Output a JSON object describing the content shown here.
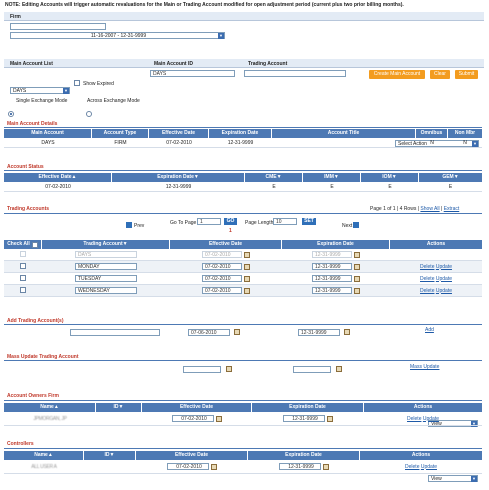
{
  "note": "NOTE: Editing Accounts will trigger automatic revaluations for the Main or Trading Account modified for open adjustment period (current plus two prior billing months).",
  "firm": {
    "label": "Firm",
    "value": "",
    "date_range": "11-16-2007 - 12-31-9999"
  },
  "filters": {
    "main_list_label": "Main Account List",
    "main_list_value": "DAYS",
    "main_id_label": "Main Account ID",
    "main_id_value": "DAYS",
    "trading_label": "Trading Account",
    "trading_value": "",
    "show_expired": "Show Expired",
    "btn_create": "Create Main Account",
    "btn_clear": "Clear",
    "btn_submit": "Submit",
    "mode_single": "Single Exchange Mode",
    "mode_across": "Across Exchange Mode"
  },
  "main_details": {
    "title": "Main Account Details",
    "select_action": "Select Action",
    "headers": [
      "Main Account",
      "Account Type",
      "Effective Date",
      "Expiration Date",
      "Account Title",
      "Omnibus",
      "Non Mbr"
    ],
    "row": [
      "DAYS",
      "FIRM",
      "07-02-2010",
      "12-31-9999",
      "",
      "N",
      "N"
    ]
  },
  "account_status": {
    "title": "Account Status",
    "headers": [
      "Effective Date▲",
      "Expiration Date▼",
      "CME▼",
      "IMM▼",
      "IOM▼",
      "GEM▼"
    ],
    "row": [
      "07-02-2010",
      "12-31-9999",
      "E",
      "E",
      "E",
      "E"
    ]
  },
  "trading_accounts": {
    "title": "Trading Accounts",
    "page_info": "Page 1 of 1",
    "rows_info": "4 Rows",
    "show_all": "Show All",
    "extract": "Extract",
    "prev": "Prev",
    "next": "Next",
    "goto_label": "Go To Page",
    "goto_value": "1",
    "go": "GO",
    "page_length_label": "Page Length",
    "page_length_value": "10",
    "set": "SET",
    "page_num": "1",
    "headers": [
      "Check All",
      "Trading Account▼",
      "Effective Date",
      "Expiration Date",
      "Actions"
    ],
    "rows": [
      {
        "name": "DAYS",
        "eff": "07-02-2010",
        "exp": "12-31-9999",
        "disabled": true,
        "delete": "",
        "update": ""
      },
      {
        "name": "MONDAY",
        "eff": "07-02-2010",
        "exp": "12-31-9999",
        "disabled": false,
        "delete": "Delete",
        "update": "Update"
      },
      {
        "name": "TUESDAY",
        "eff": "07-02-2010",
        "exp": "12-31-9999",
        "disabled": false,
        "delete": "Delete",
        "update": "Update"
      },
      {
        "name": "WEDNESDAY",
        "eff": "07-02-2010",
        "exp": "12-31-9999",
        "disabled": false,
        "delete": "Delete",
        "update": "Update"
      }
    ]
  },
  "add_trading": {
    "title": "Add Trading Account(s)",
    "eff": "07-06-2010",
    "exp": "12-31-9999",
    "add": "Add"
  },
  "mass_update": {
    "title": "Mass Update Trading Account",
    "link": "Mass Update"
  },
  "owners": {
    "title": "Account Owners Firm",
    "view": "View",
    "headers": [
      "Name▲",
      "ID▼",
      "Effective Date",
      "Expiration Date",
      "Actions"
    ],
    "row": {
      "name": "JPMORGAN, JP",
      "id": "",
      "eff": "07-02-2010",
      "exp": "12-31-9999",
      "delete": "Delete",
      "update": "Update"
    }
  },
  "controllers": {
    "title": "Controllers",
    "view": "View",
    "headers": [
      "Name▲",
      "ID▼",
      "Effective Date",
      "Expiration Date",
      "Actions"
    ],
    "row": {
      "name": "ALL USER A",
      "id": "",
      "eff": "07-02-2010",
      "exp": "12-31-9999",
      "delete": "Delete",
      "update": "Update"
    }
  }
}
